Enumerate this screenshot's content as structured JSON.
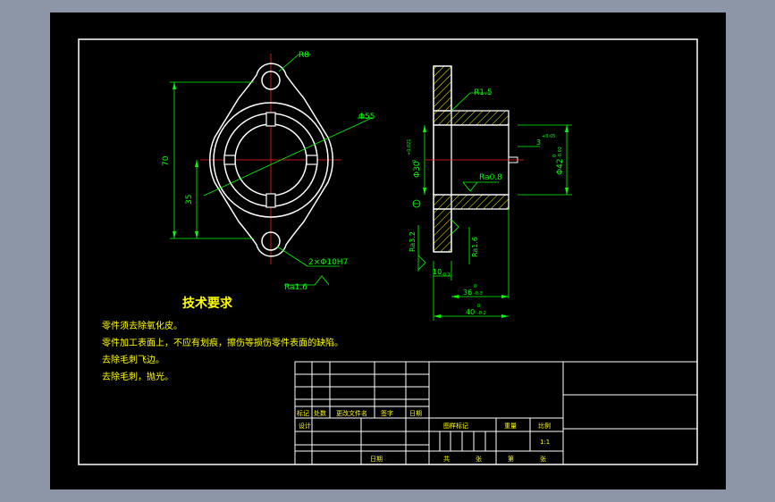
{
  "colors": {
    "background": "#000000",
    "outline": "#ffffff",
    "green": "#00ff00",
    "center_line": "#ff2020",
    "hatch": "#ffff00",
    "title_text": "#ffff00"
  },
  "dimensions": {
    "r8": "R8",
    "d55": "Φ55",
    "d70": "70",
    "d35": "35",
    "holes": "2×Φ10H7",
    "ra16_left": "Ra1.6",
    "r15": "R1.5",
    "ra08": "Ra0.8",
    "d30": "Φ30",
    "d30_tol_top": "+0.021",
    "d30_tol_bot": "0",
    "d3": "3",
    "d3_tol": "+0.05",
    "d42": "Φ42",
    "d42_tol_top": "0",
    "d42_tol_bot": "-0.02",
    "ra32": "Ra3.2",
    "ra16_right": "Ra1.6",
    "d10": "10",
    "d10_tol_bot": "-0.1",
    "d36": "36",
    "d36_tol_top": "0",
    "d36_tol_bot": "-0.3",
    "d40": "40",
    "d40_tol_top": "0",
    "d40_tol_bot": "-0.2"
  },
  "tech": {
    "title": "技术要求",
    "lines": [
      "零件须去除氧化皮。",
      "零件加工表面上，不应有划痕，擦伤等损伤零件表面的缺陷。",
      "去除毛刺飞边。",
      "去除毛刺，抛光。"
    ]
  },
  "title_block": {
    "mark": "标记",
    "count": "处数",
    "change_doc": "更改文件名",
    "signature": "签字",
    "date": "日期",
    "designer": "设计",
    "date2": "日期",
    "stage_mark": "图样标记",
    "weight": "重量",
    "scale": "比例",
    "scale_value": "1:1",
    "total": "共",
    "sheet_unit": "张",
    "page_no": "第",
    "page_unit": "张"
  }
}
